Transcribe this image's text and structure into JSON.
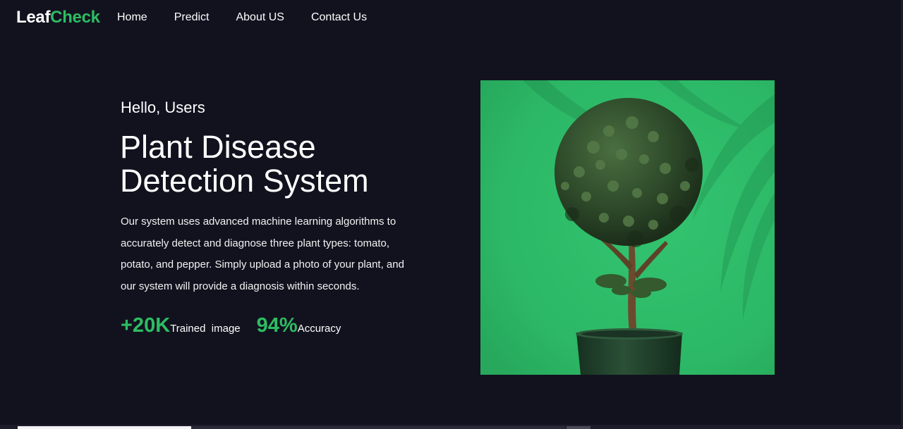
{
  "nav": {
    "logo_part1": "Leaf",
    "logo_part2": "Check",
    "links": [
      "Home",
      "Predict",
      "About US",
      "Contact Us"
    ]
  },
  "hero": {
    "greeting": "Hello, Users",
    "title_line1": "Plant Disease",
    "title_line2": "Detection System",
    "description": "Our system uses advanced machine learning algorithms to accurately detect and diagnose three plant types: tomato, potato, and pepper. Simply upload a photo of your plant, and our system will provide a diagnosis within seconds.",
    "stats": [
      {
        "value": "+20K",
        "label": "Trained  image"
      },
      {
        "value": "94%",
        "label": "Accuracy"
      }
    ],
    "image_alt": "potted topiary tree on green background"
  },
  "colors": {
    "background": "#12121f",
    "accent": "#2dbd62",
    "image_background": "#2cb866"
  }
}
